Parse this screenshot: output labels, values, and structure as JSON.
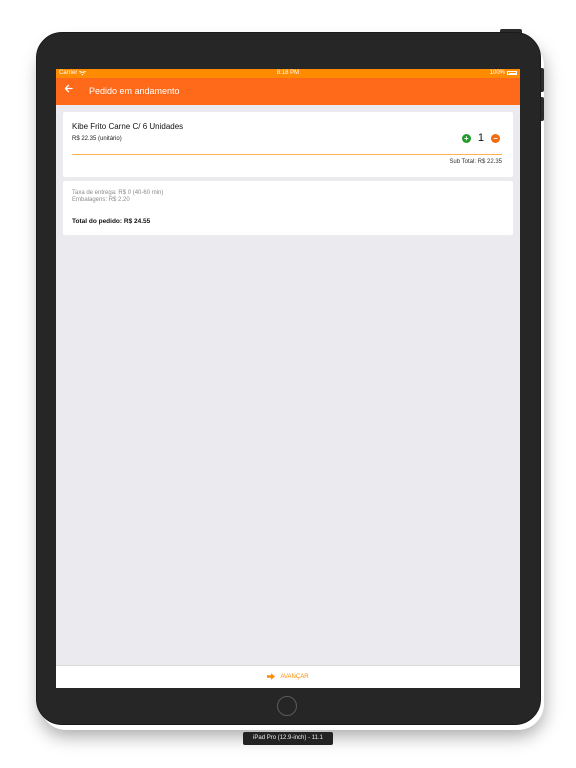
{
  "status_bar": {
    "carrier": "Carrier",
    "time": "8:18 PM",
    "battery": "100%"
  },
  "nav": {
    "back_icon": "arrow-left-icon",
    "title": "Pedido em andamento"
  },
  "item": {
    "name": "Kibe Frito Carne C/ 6 Unidades",
    "price": "R$ 22.35 (unitário)",
    "quantity": "1",
    "plus_symbol": "+",
    "minus_symbol": "−",
    "subtotal": "Sub Total: R$ 22.35"
  },
  "summary": {
    "delivery_fee": "Taxa de entrega: R$ 0 (40-60 min)",
    "packaging": "Embalagens: R$ 2.20",
    "total": "Total do pedido: R$ 24.55"
  },
  "footer": {
    "advance_label": "AVANÇAR",
    "advance_icon": "arrow-right-icon"
  },
  "device_label": "iPad Pro (12.9-inch) - 11.1",
  "colors": {
    "status_bar": "#ff8c00",
    "nav_bar": "#ff6a1a",
    "plus": "#1f9a2b",
    "minus": "#f26a10",
    "accent": "#ff8c00"
  }
}
